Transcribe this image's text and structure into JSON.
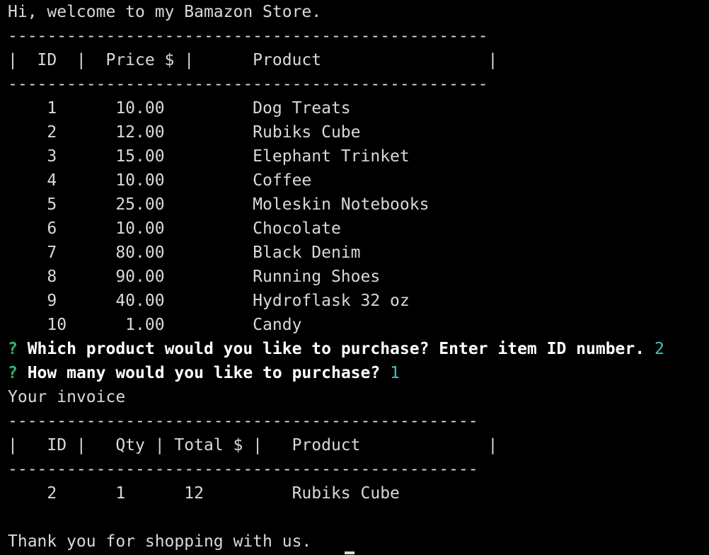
{
  "welcome": "Hi, welcome to my Bamazon Store.",
  "products_table": {
    "border": "-------------------------------------------------",
    "header": "|  ID  |  Price $ |      Product                 |",
    "rows": [
      "    1      10.00         Dog Treats",
      "    2      12.00         Rubiks Cube",
      "    3      15.00         Elephant Trinket",
      "    4      10.00         Coffee",
      "    5      25.00         Moleskin Notebooks",
      "    6      10.00         Chocolate",
      "    7      80.00         Black Denim",
      "    8      90.00         Running Shoes",
      "    9      40.00         Hydroflask 32 oz",
      "    10      1.00         Candy"
    ]
  },
  "prompts": [
    {
      "mark": "?",
      "question": " Which product would you like to purchase? Enter item ID number. ",
      "answer": "2"
    },
    {
      "mark": "?",
      "question": " How many would you like to purchase? ",
      "answer": "1"
    }
  ],
  "invoice": {
    "title": "Your invoice",
    "border": "------------------------------------------------",
    "header": "|   ID |   Qty | Total $ |   Product             |",
    "row": "    2      1      12         Rubiks Cube"
  },
  "thanks": "Thank you for shopping with us."
}
